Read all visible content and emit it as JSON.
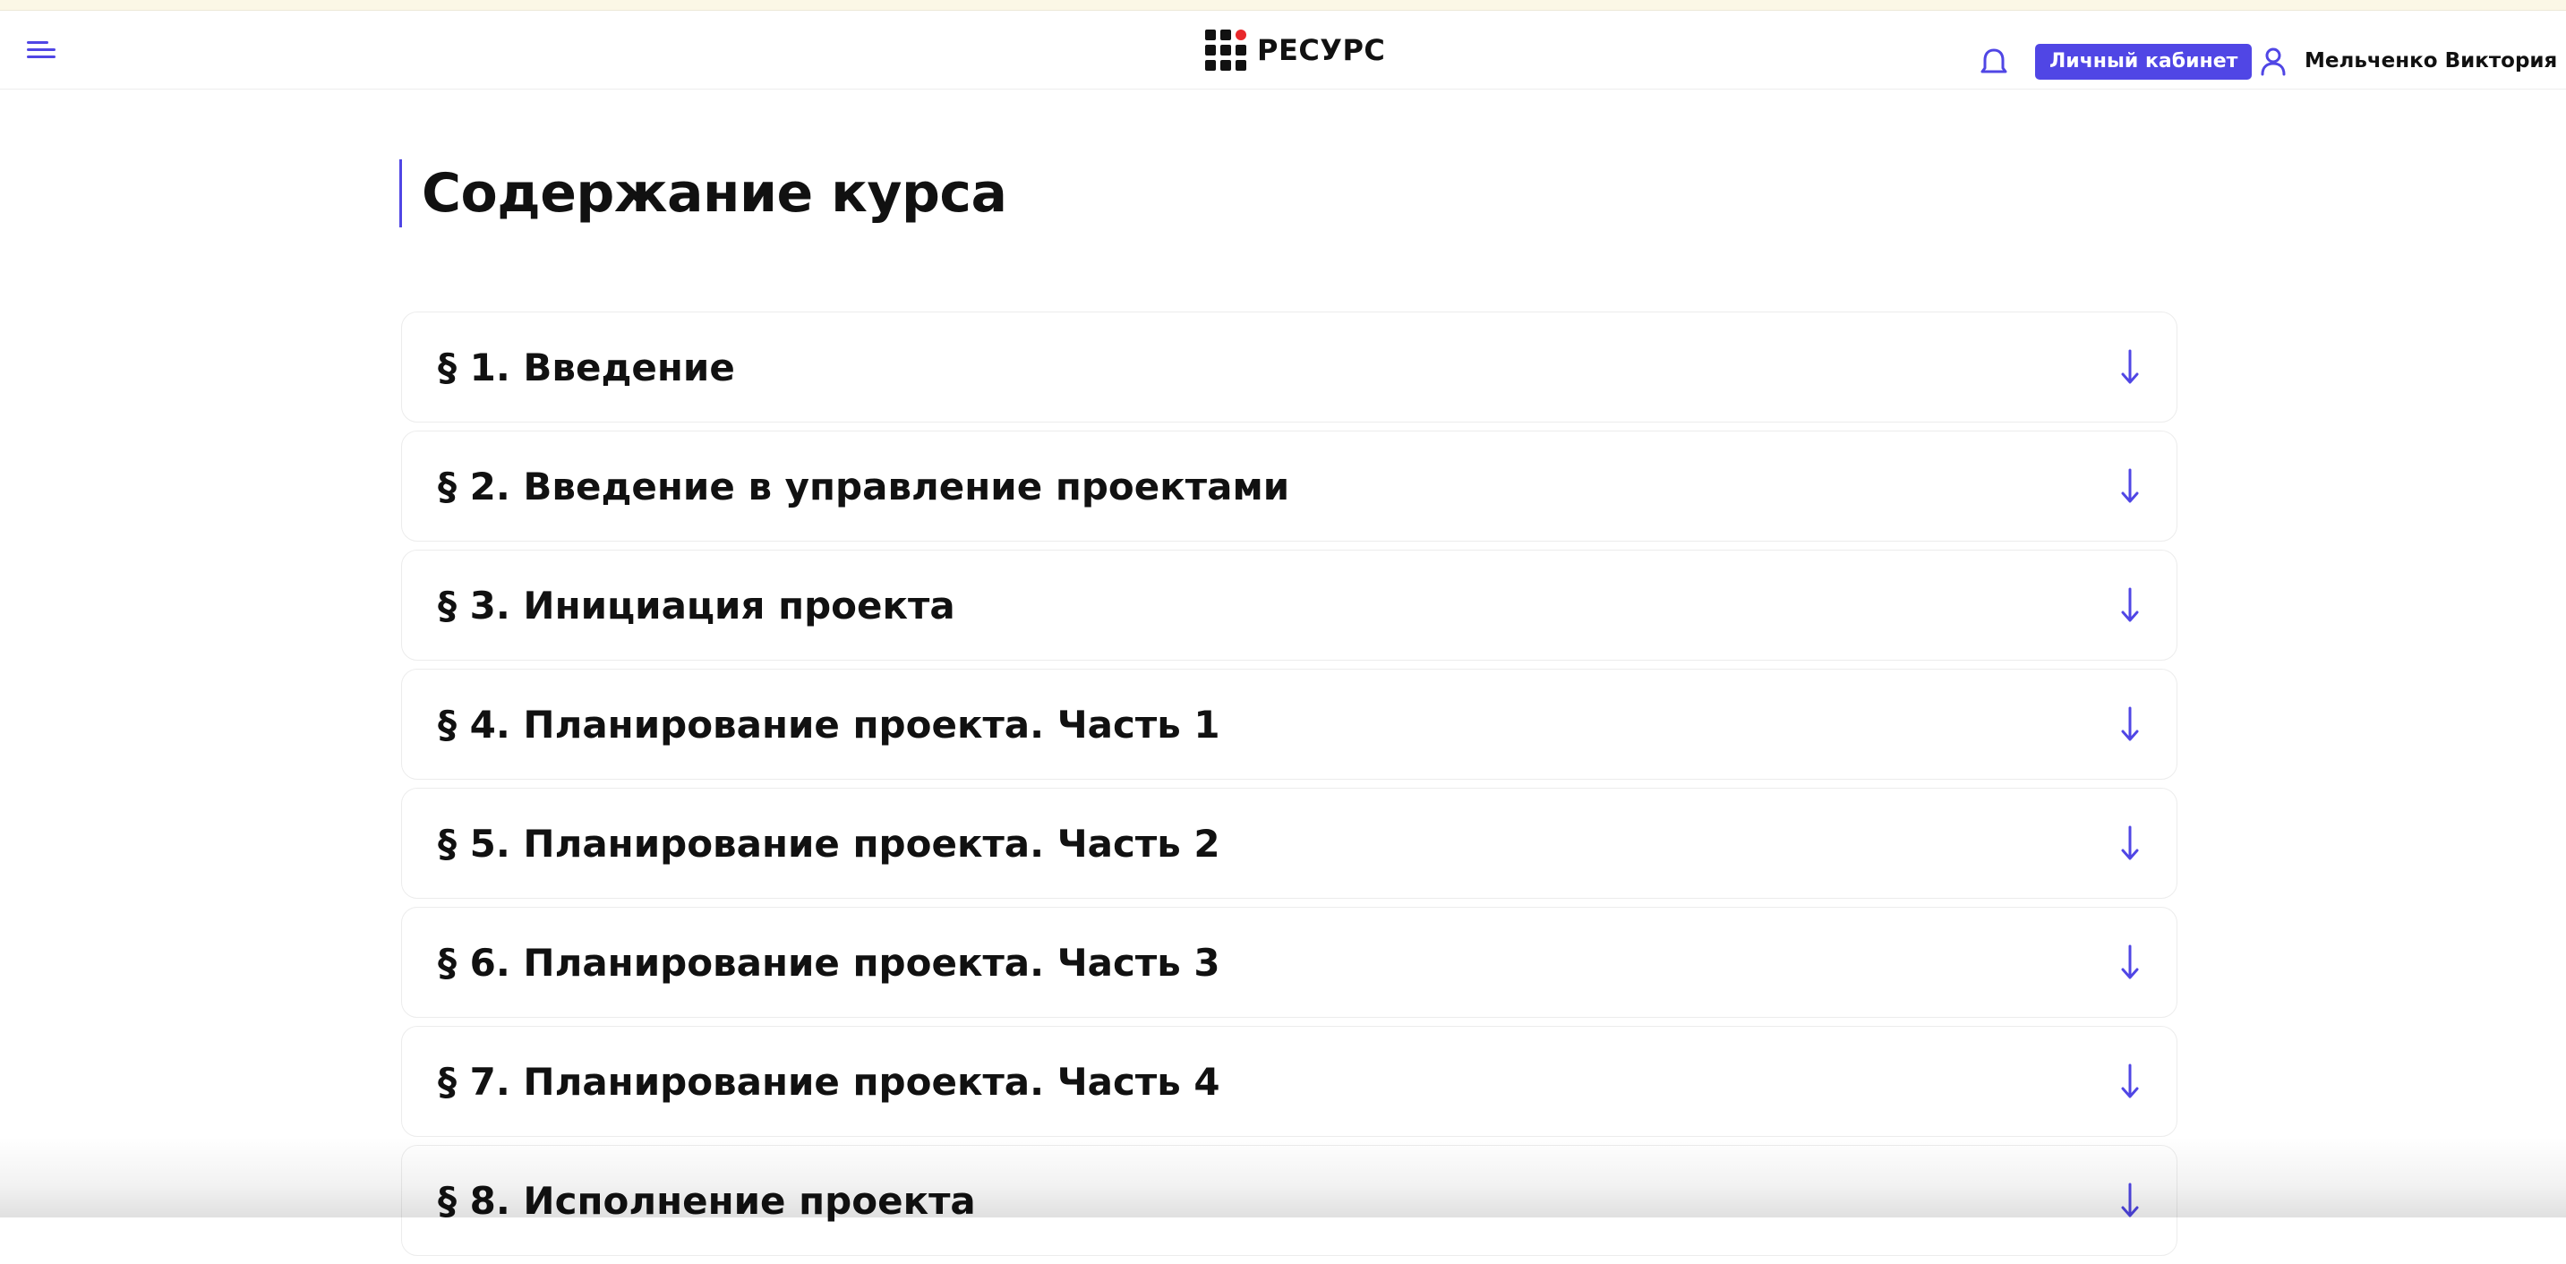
{
  "header": {
    "menu_icon": "menu-icon",
    "logo_text": "РЕСУРС",
    "bell_icon": "bell-icon",
    "cabinet_label": "Личный кабинет",
    "user_icon": "user-icon",
    "user_name": "Мельченко Виктория",
    "caret_icon": "caret-down-icon"
  },
  "colors": {
    "accent": "#5046e5",
    "logo_dot": "#e8282b",
    "text": "#111111"
  },
  "page": {
    "title": "Содержание курса"
  },
  "sections": [
    {
      "title": "§ 1. Введение",
      "icon": "arrow-down-icon"
    },
    {
      "title": "§ 2. Введение в управление проектами",
      "icon": "arrow-down-icon"
    },
    {
      "title": "§ 3. Инициация проекта",
      "icon": "arrow-down-icon"
    },
    {
      "title": "§ 4. Планирование проекта. Часть 1",
      "icon": "arrow-down-icon"
    },
    {
      "title": "§ 5. Планирование проекта. Часть 2",
      "icon": "arrow-down-icon"
    },
    {
      "title": "§ 6. Планирование проекта. Часть 3",
      "icon": "arrow-down-icon"
    },
    {
      "title": "§ 7. Планирование проекта. Часть 4",
      "icon": "arrow-down-icon"
    },
    {
      "title": "§ 8. Исполнение проекта",
      "icon": "arrow-down-icon"
    }
  ]
}
